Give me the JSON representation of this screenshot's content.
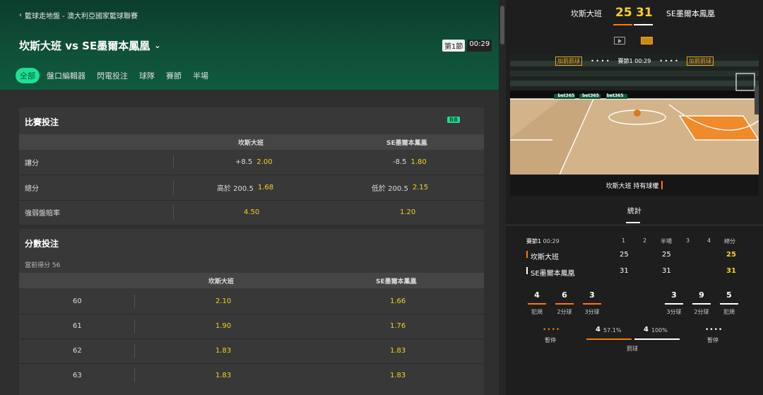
{
  "breadcrumb": "籃球走地盤 - 澳大利亞國家籃球聯賽",
  "match": {
    "title": "坎斯大班 vs SE墨爾本鳳凰",
    "period": "第1節",
    "time": "00:29"
  },
  "tabs": [
    "全部",
    "盤口編輯器",
    "閃電投注",
    "球隊",
    "賽節",
    "半場"
  ],
  "match_bets": {
    "title": "比賽投注",
    "badge": "BB",
    "col_home": "坎斯大班",
    "col_away": "SE墨爾本鳳凰",
    "rows": [
      {
        "label": "讓分",
        "home_line": "+8.5",
        "home_odds": "2.00",
        "away_line": "-8.5",
        "away_odds": "1.80"
      },
      {
        "label": "總分",
        "home_line": "高於 200.5",
        "home_odds": "1.68",
        "away_line": "低於 200.5",
        "away_odds": "2.15"
      },
      {
        "label": "強弱盤賠率",
        "home_line": "",
        "home_odds": "4.50",
        "away_line": "",
        "away_odds": "1.20"
      }
    ]
  },
  "score_bets": {
    "title": "分數投注",
    "subtitle": "當前得分 56",
    "col_home": "坎斯大班",
    "col_away": "SE墨爾本鳳凰",
    "rows": [
      {
        "score": "60",
        "home": "2.10",
        "away": "1.66"
      },
      {
        "score": "61",
        "home": "1.90",
        "away": "1.76"
      },
      {
        "score": "62",
        "home": "1.83",
        "away": "1.83"
      },
      {
        "score": "63",
        "home": "1.83",
        "away": "1.83"
      }
    ]
  },
  "scoreboard": {
    "home": "坎斯大班",
    "away": "SE墨爾本鳳凰",
    "home_score": "25",
    "away_score": "31"
  },
  "court": {
    "left_tag": "加罰罰球",
    "right_tag": "加罰罰球",
    "center": "賽節1 00:29",
    "ad": "bet365"
  },
  "possession": "坎斯大班 持有球權",
  "stats": {
    "tab": "統計",
    "header": {
      "period": "賽節1",
      "time": "00:29",
      "cols": [
        "1",
        "2",
        "半場",
        "3",
        "4",
        "總分"
      ]
    },
    "teams": [
      {
        "name": "坎斯大班",
        "q1": "25",
        "half": "25",
        "total": "25"
      },
      {
        "name": "SE墨爾本鳳凰",
        "q1": "31",
        "half": "31",
        "total": "31"
      }
    ],
    "home_boxes": [
      {
        "v": "4",
        "l": "犯規"
      },
      {
        "v": "6",
        "l": "2分球"
      },
      {
        "v": "3",
        "l": "3分球"
      }
    ],
    "away_boxes": [
      {
        "v": "3",
        "l": "3分球"
      },
      {
        "v": "9",
        "l": "2分球"
      },
      {
        "v": "5",
        "l": "犯規"
      }
    ],
    "timeout_label": "暫停",
    "ft": {
      "home_v": "4",
      "home_pct": "57.1%",
      "away_v": "4",
      "away_pct": "100%",
      "label": "罰球"
    }
  }
}
